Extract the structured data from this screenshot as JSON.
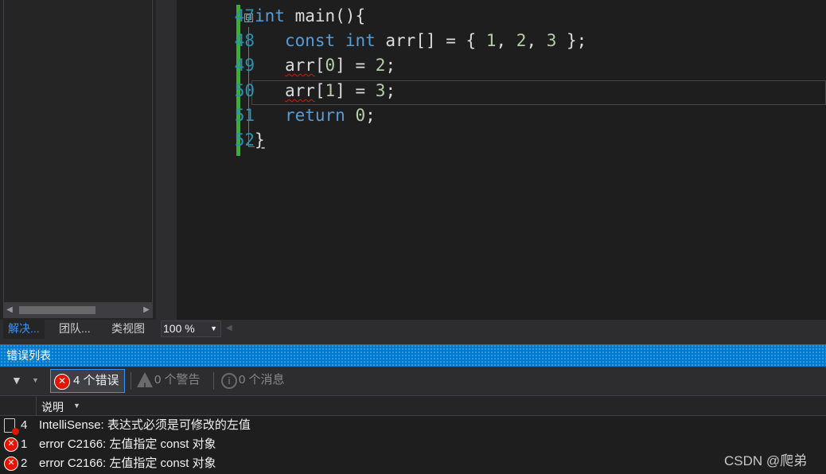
{
  "editor": {
    "lines": [
      {
        "no": "47"
      },
      {
        "no": "48"
      },
      {
        "no": "49"
      },
      {
        "no": "50"
      },
      {
        "no": "51"
      },
      {
        "no": "52"
      }
    ],
    "code": {
      "l47_kw": "int",
      "l47_rest": " main(){",
      "l48_kw1": "const",
      "l48_kw2": "int",
      "l48_rest": " arr[] = { ",
      "l48_n1": "1",
      "l48_n2": "2",
      "l48_n3": "3",
      "l49_ident": "arr",
      "l49_idx": "[0]",
      "l49_eq": " = ",
      "l49_val": "2",
      "l50_ident": "arr",
      "l50_idx": "[1]",
      "l50_eq": " = ",
      "l50_val": "3",
      "l51_kw": "return",
      "l51_val": "0",
      "l52": "}",
      "collapse": "⊟"
    }
  },
  "strip": {
    "tabs": [
      "解决...",
      "团队...",
      "类视图"
    ],
    "zoom": "100 %"
  },
  "error_list": {
    "title": "错误列表",
    "filters": {
      "errors": "4 个错误",
      "warnings": "0 个警告",
      "messages": "0 个消息"
    },
    "column": "说明",
    "rows": [
      {
        "num": "4",
        "msg": "IntelliSense:  表达式必须是可修改的左值"
      },
      {
        "num": "1",
        "msg": "error C2166: 左值指定 const 对象"
      },
      {
        "num": "2",
        "msg": "error C2166: 左值指定 const 对象"
      }
    ]
  },
  "watermark": "CSDN @爬弟",
  "icons": {
    "error": "error-icon",
    "warning": "warning-icon",
    "info": "info-icon",
    "filter": "filter-icon"
  },
  "colors": {
    "accent": "#007acc",
    "error": "#e51400",
    "keyword": "#569cd6",
    "number": "#b5cea8",
    "line_number": "#2b91af",
    "change_bar": "#2fb52f"
  }
}
